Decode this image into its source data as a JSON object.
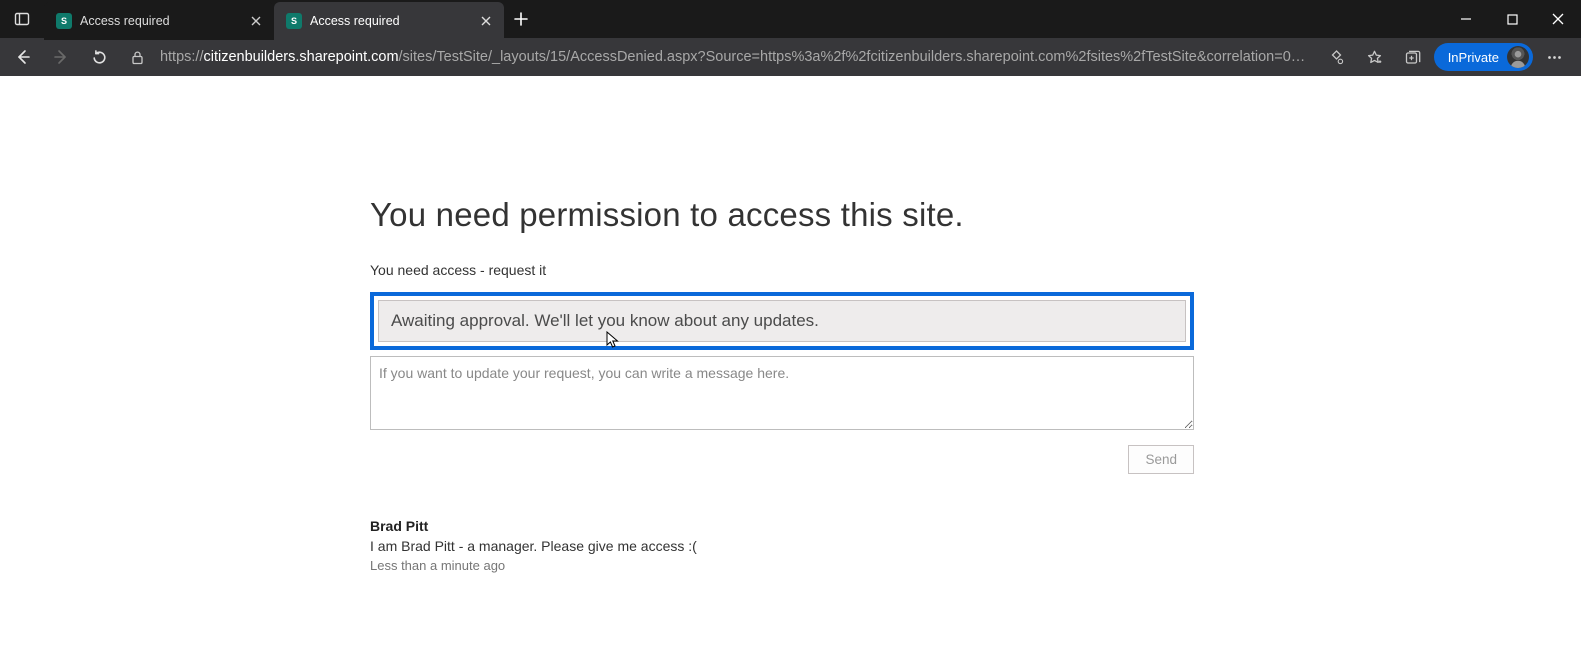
{
  "browser": {
    "tabs": [
      {
        "title": "Access required",
        "active": false
      },
      {
        "title": "Access required",
        "active": true
      }
    ],
    "url_host": "citizenbuilders.sharepoint.com",
    "url_path": "/sites/TestSite/_layouts/15/AccessDenied.aspx?Source=https%3a%2f%2fcitizenbuilders.sharepoint.com%2fsites%2fTestSite&correlation=0d…",
    "url_scheme": "https://",
    "inprivate_label": "InPrivate"
  },
  "page": {
    "title": "You need permission to access this site.",
    "subtitle": "You need access - request it",
    "status_message": "Awaiting approval. We'll let you know about any updates.",
    "message_placeholder": "If you want to update your request, you can write a message here.",
    "send_label": "Send",
    "prev_request": {
      "name": "Brad Pitt",
      "message": "I am Brad Pitt - a manager. Please give me access :(",
      "timestamp": "Less than a minute ago"
    }
  }
}
